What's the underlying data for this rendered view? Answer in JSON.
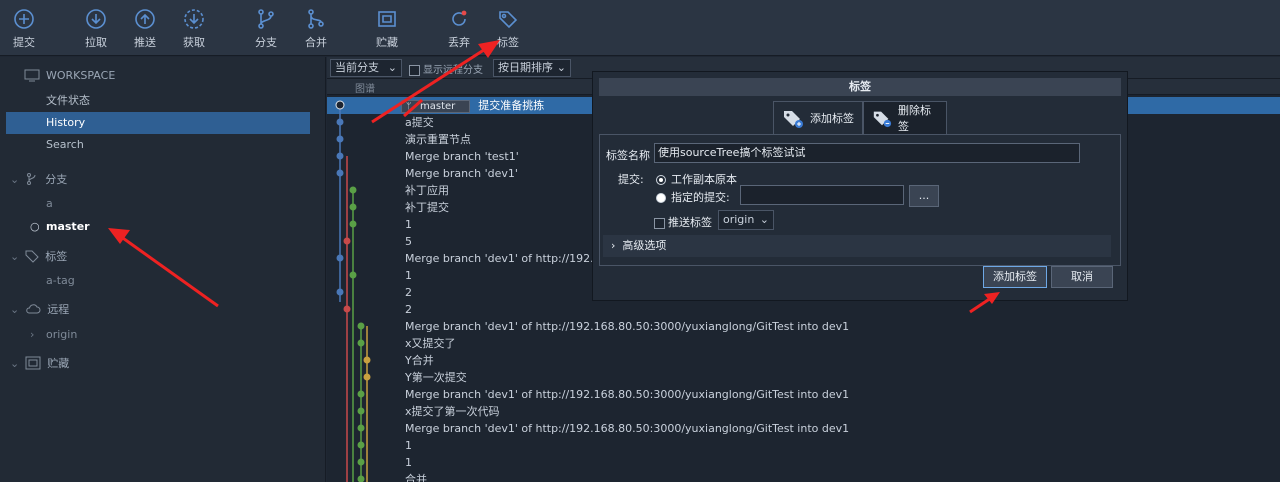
{
  "toolbar": {
    "items": [
      {
        "label": "提交",
        "icon": "commit-icon"
      },
      {
        "label": "拉取",
        "icon": "pull-icon"
      },
      {
        "label": "推送",
        "icon": "push-icon"
      },
      {
        "label": "获取",
        "icon": "fetch-icon"
      },
      {
        "label": "分支",
        "icon": "branch-icon"
      },
      {
        "label": "合并",
        "icon": "merge-icon"
      },
      {
        "label": "贮藏",
        "icon": "stash-icon"
      },
      {
        "label": "丢弃",
        "icon": "discard-icon"
      },
      {
        "label": "标签",
        "icon": "tag-icon"
      }
    ]
  },
  "sidebar": {
    "workspace_label": "WORKSPACE",
    "workspace_items": [
      "文件状态",
      "History",
      "Search"
    ],
    "branches_label": "分支",
    "branches": [
      "a",
      "master"
    ],
    "tags_label": "标签",
    "tags": [
      "a-tag"
    ],
    "remotes_label": "远程",
    "remotes": [
      "origin"
    ],
    "stash_label": "贮藏"
  },
  "filterbar": {
    "branch_select": "当前分支",
    "show_remote_label": "显示远程分支",
    "sort_select": "按日期排序",
    "graph_col": "图谱"
  },
  "commits": [
    {
      "msg": "提交准备挑拣",
      "branch_tag": "master"
    },
    {
      "msg": "a提交"
    },
    {
      "msg": "演示重置节点"
    },
    {
      "msg": "Merge branch 'test1'"
    },
    {
      "msg": "Merge branch 'dev1'"
    },
    {
      "msg": "补丁应用"
    },
    {
      "msg": "补丁提交"
    },
    {
      "msg": "1"
    },
    {
      "msg": "5"
    },
    {
      "msg": "Merge branch 'dev1' of http://192.1"
    },
    {
      "msg": "1"
    },
    {
      "msg": "2"
    },
    {
      "msg": "2"
    },
    {
      "msg": "Merge branch 'dev1' of http://192.168.80.50:3000/yuxianglong/GitTest into dev1"
    },
    {
      "msg": "x又提交了"
    },
    {
      "msg": "Y合并"
    },
    {
      "msg": "Y第一次提交"
    },
    {
      "msg": "Merge branch 'dev1' of http://192.168.80.50:3000/yuxianglong/GitTest into dev1"
    },
    {
      "msg": "x提交了第一次代码"
    },
    {
      "msg": "Merge branch 'dev1' of http://192.168.80.50:3000/yuxianglong/GitTest into dev1"
    },
    {
      "msg": "1"
    },
    {
      "msg": "1"
    },
    {
      "msg": "合并"
    }
  ],
  "dialog": {
    "title": "标签",
    "tab_add": "添加标签",
    "tab_delete": "删除标签",
    "tag_name_label": "标签名称",
    "tag_name_value": "使用sourceTree搞个标签试试",
    "commit_label": "提交:",
    "opt_working_copy": "工作副本原本",
    "opt_specified": "指定的提交:",
    "browse_btn": "...",
    "push_tag_label": "推送标签",
    "remote_select": "origin",
    "advanced_label": "高级选项",
    "add_btn": "添加标签",
    "cancel_btn": "取消"
  },
  "colors": {
    "accent": "#2f6aa6",
    "arrow": "#ee2222",
    "graph_blue": "#4a78b8",
    "graph_green": "#5aa046",
    "graph_red": "#c84a4a",
    "graph_yellow": "#c8a040"
  }
}
